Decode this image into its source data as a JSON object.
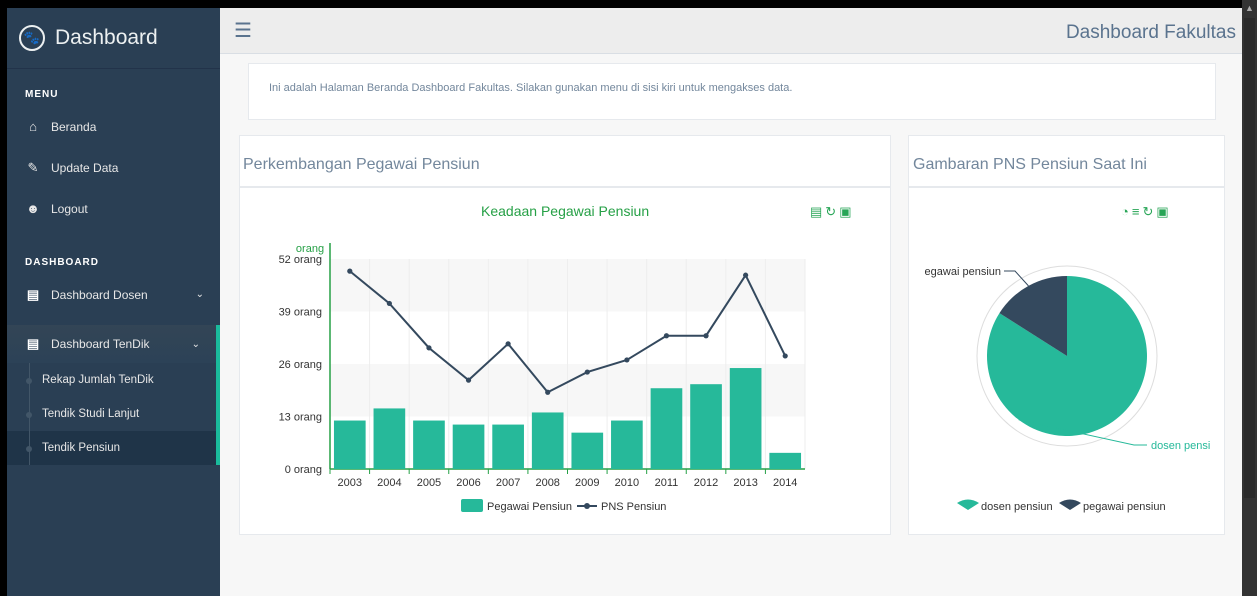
{
  "sidebar": {
    "brand": "Dashboard",
    "menu_title": "MENU",
    "menu": [
      {
        "label": "Beranda",
        "icon": "home-icon"
      },
      {
        "label": "Update Data",
        "icon": "edit-icon"
      },
      {
        "label": "Logout",
        "icon": "user-icon"
      }
    ],
    "dashboard_title": "DASHBOARD",
    "dashboard_dosen": "Dashboard Dosen",
    "dashboard_tendik": "Dashboard TenDik",
    "sub": [
      "Rekap Jumlah TenDik",
      "Tendik Studi Lanjut",
      "Tendik Pensiun"
    ]
  },
  "header": {
    "title": "Dashboard Fakultas"
  },
  "info": {
    "text": "Ini adalah Halaman Beranda Dashboard Fakultas. Silakan gunakan menu di sisi kiri untuk mengakses data."
  },
  "panel1": {
    "title": "Perkembangan Pegawai Pensiun"
  },
  "panel2": {
    "title": "Gambaran PNS Pensiun Saat Ini"
  },
  "colors": {
    "accent": "#1abb9c",
    "bar": "#26b99a",
    "line": "#34495e",
    "title_green": "#26a046"
  },
  "chart_data": [
    {
      "type": "bar",
      "title": "Keadaan Pegawai Pensiun",
      "ylabel": "orang",
      "categories": [
        "2003",
        "2004",
        "2005",
        "2006",
        "2007",
        "2008",
        "2009",
        "2010",
        "2011",
        "2012",
        "2013",
        "2014"
      ],
      "series": [
        {
          "name": "Pegawai Pensiun",
          "type": "bar",
          "values": [
            12,
            15,
            12,
            11,
            11,
            14,
            9,
            12,
            20,
            21,
            25,
            4
          ]
        },
        {
          "name": "PNS Pensiun",
          "type": "line",
          "values": [
            49,
            41,
            30,
            22,
            31,
            19,
            24,
            27,
            33,
            33,
            48,
            28
          ]
        }
      ],
      "ylim": [
        0,
        52
      ],
      "yticks": [
        "0 orang",
        "13 orang",
        "26 orang",
        "39 orang",
        "52 orang"
      ],
      "legend": "bottom"
    },
    {
      "type": "pie",
      "categories": [
        "dosen pensiun",
        "pegawai pensiun"
      ],
      "labels_shown": [
        "dosen pensi",
        "egawai pensiun"
      ],
      "values": [
        84,
        16
      ],
      "legend": "bottom"
    }
  ]
}
